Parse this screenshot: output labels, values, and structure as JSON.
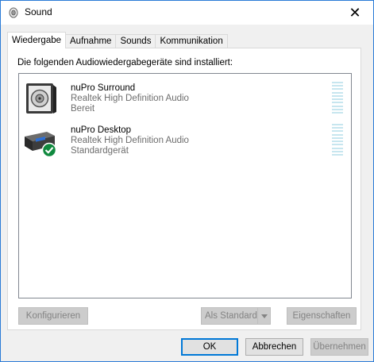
{
  "window": {
    "title": "Sound",
    "title_icon": "speaker-icon",
    "close_glyph": "✕"
  },
  "tabs": [
    {
      "label": "Wiedergabe",
      "active": true
    },
    {
      "label": "Aufnahme",
      "active": false
    },
    {
      "label": "Sounds",
      "active": false
    },
    {
      "label": "Kommunikation",
      "active": false
    }
  ],
  "panel": {
    "heading": "Die folgenden Audiowiedergabegeräte sind installiert:"
  },
  "devices": [
    {
      "name": "nuPro Surround",
      "driver": "Realtek High Definition Audio",
      "status": "Bereit",
      "icon": "speaker-device-icon",
      "is_default": false
    },
    {
      "name": "nuPro Desktop",
      "driver": "Realtek High Definition Audio",
      "status": "Standardgerät",
      "icon": "digital-output-device-icon",
      "is_default": true
    }
  ],
  "panel_buttons": {
    "configure": "Konfigurieren",
    "set_default": "Als Standard",
    "properties": "Eigenschaften"
  },
  "dialog_buttons": {
    "ok": "OK",
    "cancel": "Abbrechen",
    "apply": "Übernehmen"
  },
  "colors": {
    "accent": "#0078d7",
    "default_check": "#10893e",
    "meter": "#c7e6ef"
  }
}
